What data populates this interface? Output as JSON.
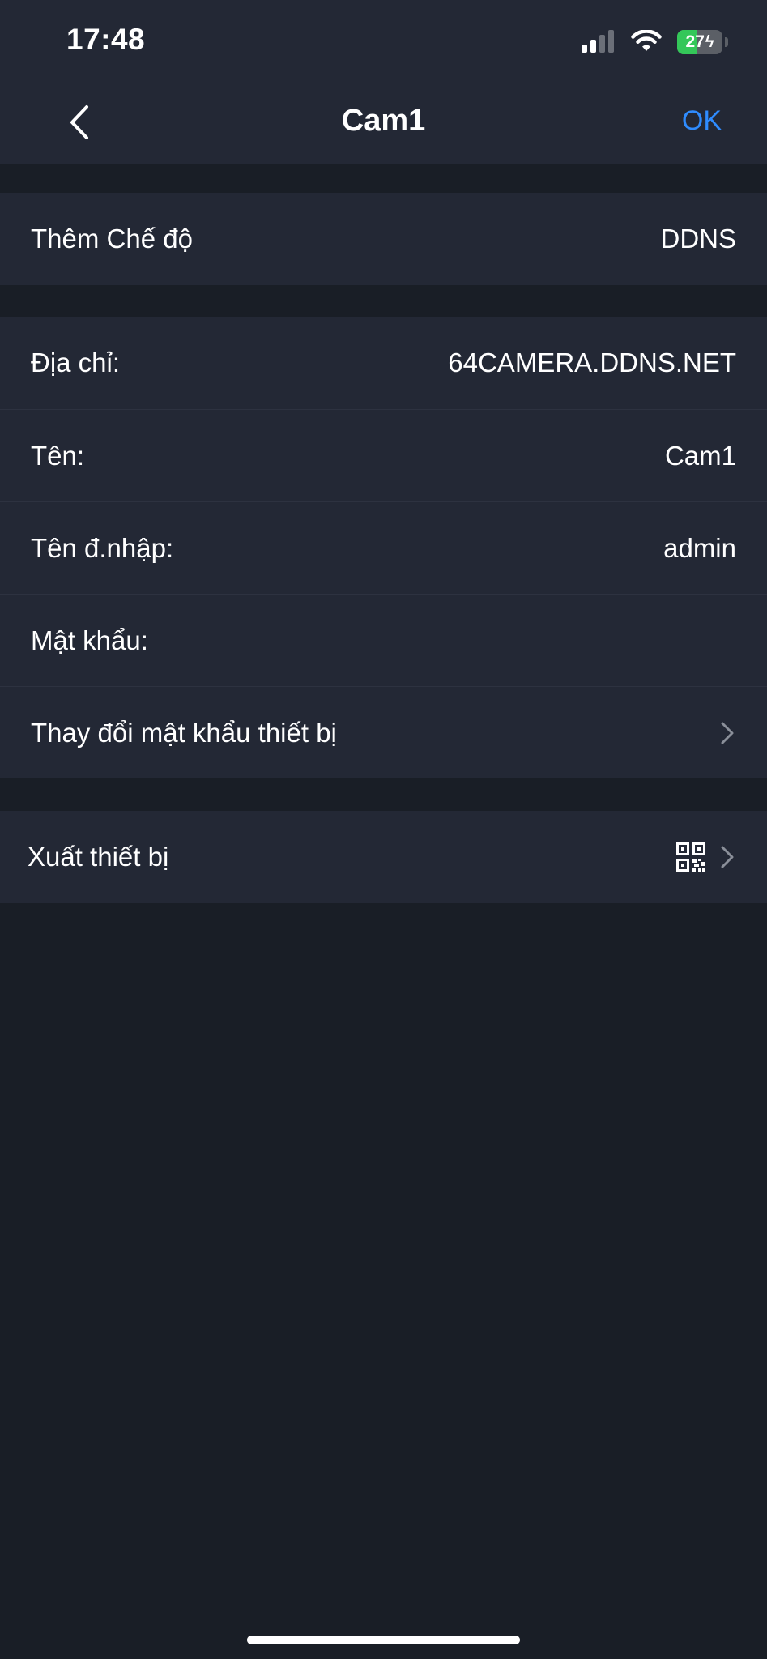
{
  "status_bar": {
    "time": "17:48",
    "battery_percent": "27",
    "battery_level": 0.27,
    "charging": true,
    "icons": [
      "signal-icon",
      "wifi-icon",
      "battery-icon"
    ]
  },
  "nav": {
    "back_icon": "chevron-left-icon",
    "title": "Cam1",
    "ok_label": "OK"
  },
  "mode_section": {
    "label": "Thêm Chế độ",
    "value": "DDNS"
  },
  "device_section": {
    "address_label": "Địa chỉ:",
    "address_value": "64CAMERA.DDNS.NET",
    "name_label": "Tên:",
    "name_value": "Cam1",
    "username_label": "Tên đ.nhập:",
    "username_value": "admin",
    "password_label": "Mật khẩu:",
    "password_value": "",
    "change_password_label": "Thay đổi mật khẩu thiết bị"
  },
  "export_section": {
    "label": "Xuất thiết bị",
    "icon": "qr-code-icon"
  },
  "colors": {
    "background": "#191e26",
    "surface": "#232835",
    "accent": "#2f8cff",
    "battery_green": "#34c759"
  }
}
